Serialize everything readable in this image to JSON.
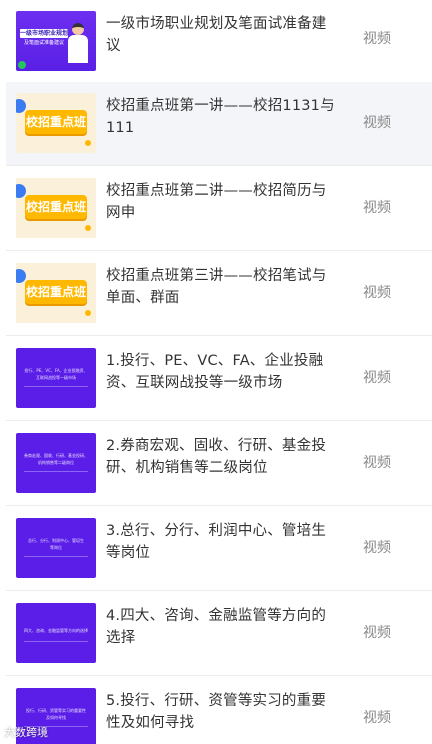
{
  "items": [
    {
      "title": "一级市场职业规划及笔面试准备建议",
      "tag": "视频",
      "thumb_style": "cover",
      "thumb_text": "一级市场职业规划",
      "thumb_text2": "及笔面试准备建议"
    },
    {
      "title": "校招重点班第一讲——校招1131与111",
      "tag": "视频",
      "thumb_style": "orange",
      "thumb_text": "校招重点班"
    },
    {
      "title": "校招重点班第二讲——校招简历与网申",
      "tag": "视频",
      "thumb_style": "orange",
      "thumb_text": "校招重点班"
    },
    {
      "title": "校招重点班第三讲——校招笔试与单面、群面",
      "tag": "视频",
      "thumb_style": "orange",
      "thumb_text": "校招重点班"
    },
    {
      "title": "1.投行、PE、VC、FA、企业投融资、互联网战投等一级市场",
      "tag": "视频",
      "thumb_style": "purple",
      "thumb_text": "投行、PE、VC、FA、企业投融资、",
      "thumb_text2": "互联网战投等一级市场"
    },
    {
      "title": "2.券商宏观、固收、行研、基金投研、机构销售等二级岗位",
      "tag": "视频",
      "thumb_style": "purple",
      "thumb_text": "券商宏观、固收、行研、基金投研、",
      "thumb_text2": "机构销售等二级岗位"
    },
    {
      "title": "3.总行、分行、利润中心、管培生等岗位",
      "tag": "视频",
      "thumb_style": "purple",
      "thumb_text": "总行、分行、利润中心、管培生",
      "thumb_text2": "等岗位"
    },
    {
      "title": "4.四大、咨询、金融监管等方向的选择",
      "tag": "视频",
      "thumb_style": "purple",
      "thumb_text": "四大、咨询、金融监管等方向的选择",
      "thumb_text2": ""
    },
    {
      "title": "5.投行、行研、资管等实习的重要性及如何寻找",
      "tag": "视频",
      "thumb_style": "purple",
      "thumb_text": "投行、行研、资管等实习的重要性",
      "thumb_text2": "及如何寻找"
    }
  ],
  "selected_index": 1,
  "watermark": "大数跨境"
}
